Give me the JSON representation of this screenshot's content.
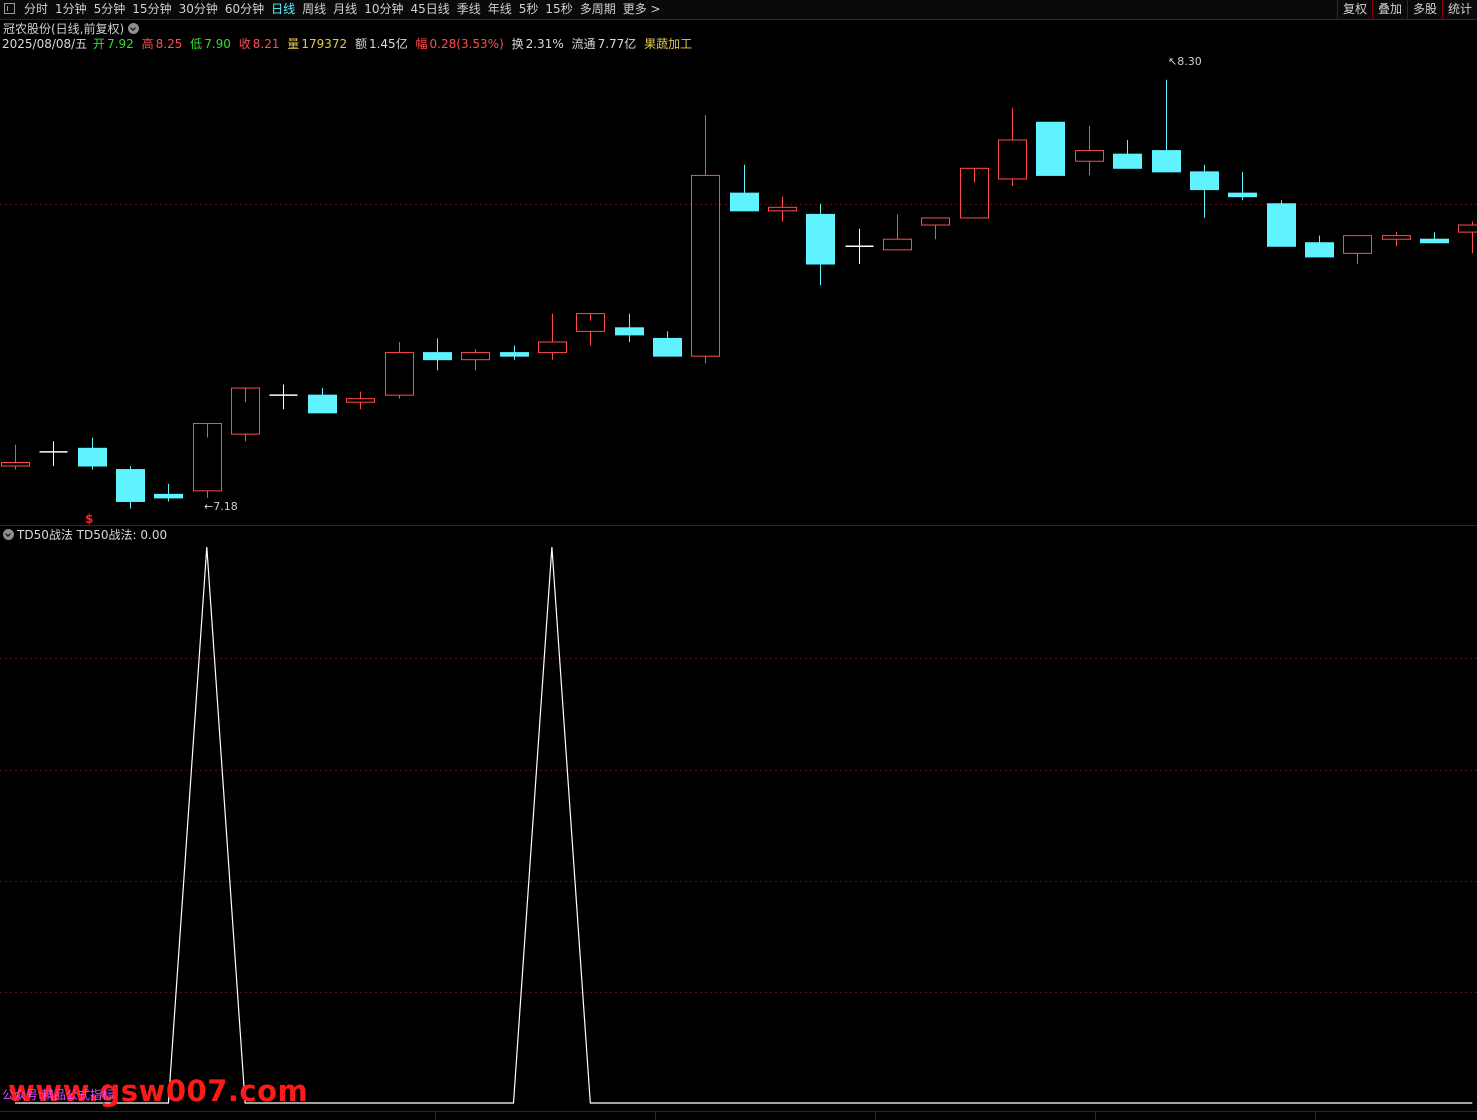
{
  "toolbar": {
    "periods": [
      "分时",
      "1分钟",
      "5分钟",
      "15分钟",
      "30分钟",
      "60分钟",
      "日线",
      "周线",
      "月线",
      "10分钟",
      "45日线",
      "季线",
      "年线",
      "5秒",
      "15秒",
      "多周期",
      "更多 >"
    ],
    "active_period": "日线",
    "right_buttons": [
      "复权",
      "叠加",
      "多股",
      "统计"
    ]
  },
  "header": {
    "title": "冠农股份(日线,前复权)",
    "quote": {
      "date": "2025/08/08/五",
      "open_label": "开",
      "open": "7.92",
      "high_label": "高",
      "high": "8.25",
      "low_label": "低",
      "low": "7.90",
      "close_label": "收",
      "close": "8.21",
      "volume_label": "量",
      "volume": "179372",
      "amount_label": "额",
      "amount": "1.45亿",
      "change_label": "幅",
      "change": "0.28(3.53%)",
      "turnover_label": "换",
      "turnover": "2.31%",
      "float_label": "流通",
      "float": "7.77亿",
      "sector": "果蔬加工"
    }
  },
  "price_chart": {
    "high_marker": "8.30",
    "low_marker": "7.18",
    "signal_marker": "$"
  },
  "indicator": {
    "name": "TD50战法",
    "value_label": "TD50战法: 0.00"
  },
  "watermark": {
    "main": "www.gsw007.com",
    "small": "公众号:精品公式指标"
  },
  "colors": {
    "up": "#ff4d4d",
    "down": "#5ff2ff",
    "flat": "#ffffff",
    "line": "#ffffff",
    "grid": "#5a1010",
    "border": "#8b0000"
  },
  "chart_data": [
    {
      "type": "candlestick",
      "title": "冠农股份(日线,前复权)",
      "ylim": [
        7.1,
        8.35
      ],
      "candles": [
        {
          "o": 7.21,
          "h": 7.27,
          "l": 7.2,
          "c": 7.22
        },
        {
          "o": 7.25,
          "h": 7.28,
          "l": 7.21,
          "c": 7.25
        },
        {
          "o": 7.26,
          "h": 7.29,
          "l": 7.2,
          "c": 7.21
        },
        {
          "o": 7.2,
          "h": 7.21,
          "l": 7.09,
          "c": 7.11
        },
        {
          "o": 7.13,
          "h": 7.16,
          "l": 7.11,
          "c": 7.12
        },
        {
          "o": 7.14,
          "h": 7.29,
          "l": 7.12,
          "c": 7.33
        },
        {
          "o": 7.3,
          "h": 7.39,
          "l": 7.28,
          "c": 7.43
        },
        {
          "o": 7.41,
          "h": 7.44,
          "l": 7.37,
          "c": 7.41
        },
        {
          "o": 7.41,
          "h": 7.43,
          "l": 7.37,
          "c": 7.36
        },
        {
          "o": 7.39,
          "h": 7.42,
          "l": 7.37,
          "c": 7.4
        },
        {
          "o": 7.41,
          "h": 7.56,
          "l": 7.4,
          "c": 7.53
        },
        {
          "o": 7.53,
          "h": 7.57,
          "l": 7.48,
          "c": 7.51
        },
        {
          "o": 7.51,
          "h": 7.54,
          "l": 7.48,
          "c": 7.53
        },
        {
          "o": 7.53,
          "h": 7.55,
          "l": 7.51,
          "c": 7.52
        },
        {
          "o": 7.53,
          "h": 7.64,
          "l": 7.51,
          "c": 7.56
        },
        {
          "o": 7.59,
          "h": 7.62,
          "l": 7.55,
          "c": 7.64
        },
        {
          "o": 7.6,
          "h": 7.64,
          "l": 7.56,
          "c": 7.58
        },
        {
          "o": 7.57,
          "h": 7.59,
          "l": 7.54,
          "c": 7.52
        },
        {
          "o": 7.52,
          "h": 8.2,
          "l": 7.5,
          "c": 8.03
        },
        {
          "o": 7.98,
          "h": 8.06,
          "l": 7.93,
          "c": 7.93
        },
        {
          "o": 7.93,
          "h": 7.97,
          "l": 7.9,
          "c": 7.94
        },
        {
          "o": 7.92,
          "h": 7.95,
          "l": 7.72,
          "c": 7.78
        },
        {
          "o": 7.83,
          "h": 7.88,
          "l": 7.78,
          "c": 7.83
        },
        {
          "o": 7.82,
          "h": 7.92,
          "l": 7.82,
          "c": 7.85
        },
        {
          "o": 7.89,
          "h": 7.91,
          "l": 7.85,
          "c": 7.91
        },
        {
          "o": 7.91,
          "h": 8.01,
          "l": 7.91,
          "c": 8.05
        },
        {
          "o": 8.02,
          "h": 8.22,
          "l": 8.0,
          "c": 8.13
        },
        {
          "o": 8.18,
          "h": 8.18,
          "l": 8.04,
          "c": 8.03
        },
        {
          "o": 8.07,
          "h": 8.17,
          "l": 8.03,
          "c": 8.1
        },
        {
          "o": 8.09,
          "h": 8.13,
          "l": 8.05,
          "c": 8.05
        },
        {
          "o": 8.1,
          "h": 8.3,
          "l": 8.04,
          "c": 8.04
        },
        {
          "o": 8.04,
          "h": 8.06,
          "l": 7.91,
          "c": 7.99
        },
        {
          "o": 7.98,
          "h": 8.04,
          "l": 7.96,
          "c": 7.97
        },
        {
          "o": 7.95,
          "h": 7.96,
          "l": 7.88,
          "c": 7.83
        },
        {
          "o": 7.84,
          "h": 7.86,
          "l": 7.8,
          "c": 7.8
        },
        {
          "o": 7.81,
          "h": 7.86,
          "l": 7.78,
          "c": 7.86
        },
        {
          "o": 7.85,
          "h": 7.87,
          "l": 7.83,
          "c": 7.86
        },
        {
          "o": 7.85,
          "h": 7.87,
          "l": 7.84,
          "c": 7.84
        },
        {
          "o": 7.87,
          "h": 7.9,
          "l": 7.81,
          "c": 7.89
        }
      ]
    },
    {
      "type": "line",
      "title": "TD50战法",
      "ylim": [
        0,
        100
      ],
      "series": [
        {
          "name": "TD50战法",
          "values": [
            0,
            0,
            0,
            0,
            0,
            100,
            0,
            0,
            0,
            0,
            0,
            0,
            0,
            0,
            100,
            0,
            0,
            0,
            0,
            0,
            0,
            0,
            0,
            0,
            0,
            0,
            0,
            0,
            0,
            0,
            0,
            0,
            0,
            0,
            0,
            0,
            0,
            0,
            0
          ]
        }
      ]
    }
  ]
}
